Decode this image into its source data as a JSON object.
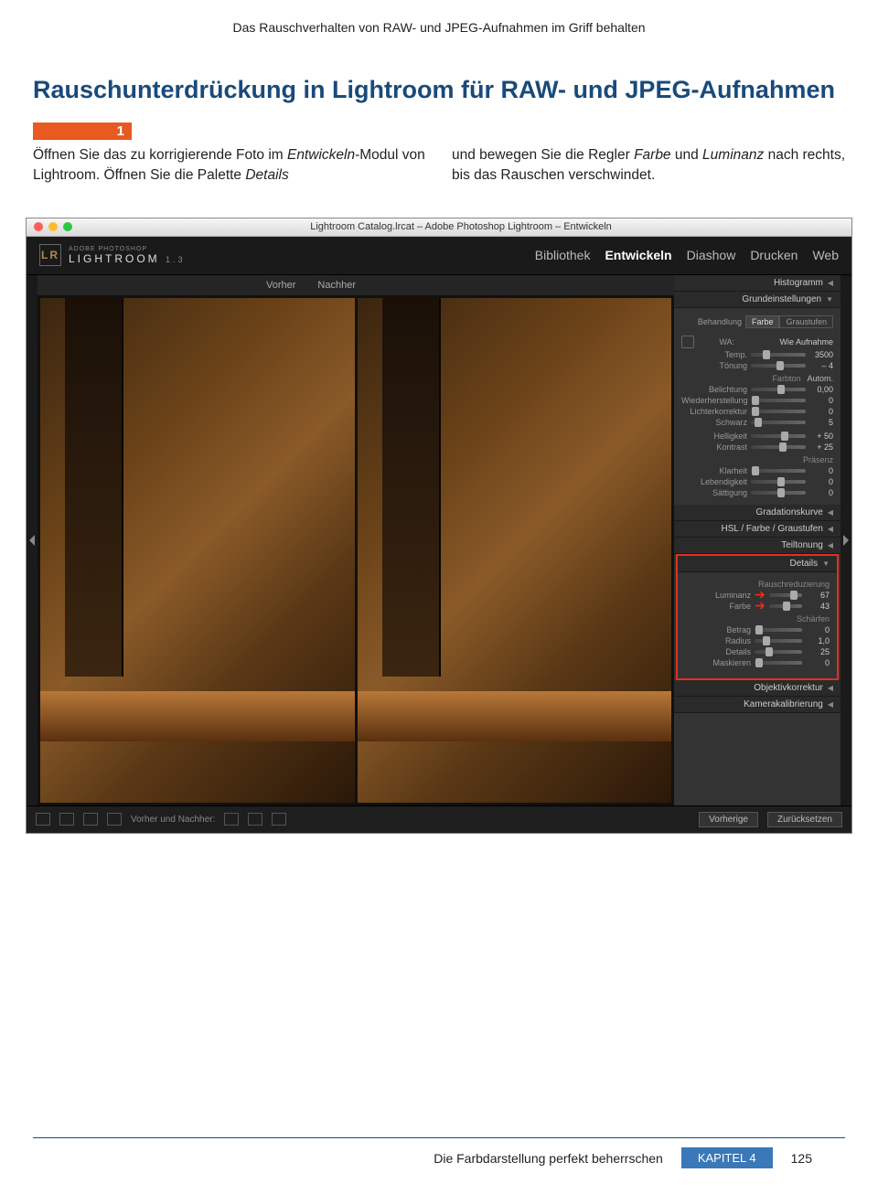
{
  "header": "Das Rauschverhalten von RAW- und JPEG-Aufnahmen im Griff behalten",
  "heading": "Rauschunterdrückung in Lightroom für RAW- und JPEG-Aufnahmen",
  "step_badge": "1",
  "body": {
    "left_a": "Öffnen Sie das zu korrigierende Foto im ",
    "left_em1": "Entwickeln",
    "left_b": "-Modul von Lightroom. Öffnen Sie die Palette ",
    "left_em2": "Details",
    "right_a": "und bewegen Sie die Regler ",
    "right_em1": "Farbe",
    "right_b": " und ",
    "right_em2": "Luminanz",
    "right_c": " nach rechts, bis das Rauschen verschwindet."
  },
  "shot": {
    "window_title": "Lightroom Catalog.lrcat – Adobe Photoshop Lightroom – Entwickeln",
    "logo_abbr": "LR",
    "logo_sub": "ADOBE PHOTOSHOP",
    "logo_name": "LIGHTROOM",
    "logo_ver": "1.3",
    "nav": [
      "Bibliothek",
      "Entwickeln",
      "Diashow",
      "Drucken",
      "Web"
    ],
    "nav_active": 1,
    "vorher": "Vorher",
    "nachher": "Nachher",
    "panels": {
      "histogramm": "Histogramm",
      "grund": "Grundeinstellungen",
      "behandlung": "Behandlung",
      "farbe": "Farbe",
      "graustufen": "Graustufen",
      "wa": "WA:",
      "wa_val": "Wie Aufnahme",
      "temp": "Temp.",
      "temp_v": "3500",
      "tonung": "Tönung",
      "tonung_v": "– 4",
      "farbton": "Farbton",
      "autom": "Autom.",
      "belicht": "Belichtung",
      "belicht_v": "0,00",
      "wieder": "Wiederherstellung",
      "wieder_v": "0",
      "lichter": "Lichterkorrektur",
      "lichter_v": "0",
      "schwarz": "Schwarz",
      "schwarz_v": "5",
      "hellig": "Helligkeit",
      "hellig_v": "+ 50",
      "kontrast": "Kontrast",
      "kontrast_v": "+ 25",
      "praesenz": "Präsenz",
      "klarheit": "Klarheit",
      "klarheit_v": "0",
      "lebendig": "Lebendigkeit",
      "lebendig_v": "0",
      "saettig": "Sättigung",
      "saettig_v": "0",
      "gradkurve": "Gradationskurve",
      "hsl": "HSL / Farbe / Graustufen",
      "teilton": "Teiltonung",
      "details": "Details",
      "rauschred": "Rauschreduzierung",
      "luminanz": "Luminanz",
      "luminanz_v": "67",
      "farbe_sl": "Farbe",
      "farbe_v": "43",
      "schaerfen": "Schärfen",
      "betrag": "Betrag",
      "betrag_v": "0",
      "radius": "Radius",
      "radius_v": "1,0",
      "details_sl": "Details",
      "details_v": "25",
      "maskieren": "Maskieren",
      "maskieren_v": "0",
      "objektiv": "Objektivkorrektur",
      "kamera": "Kamerakalibrierung"
    },
    "btm": {
      "vn": "Vorher und Nachher:",
      "prev": "Vorherige",
      "reset": "Zurücksetzen"
    }
  },
  "footer": {
    "text": "Die Farbdarstellung perfekt beherrschen",
    "chapter": "KAPITEL 4",
    "page": "125"
  }
}
